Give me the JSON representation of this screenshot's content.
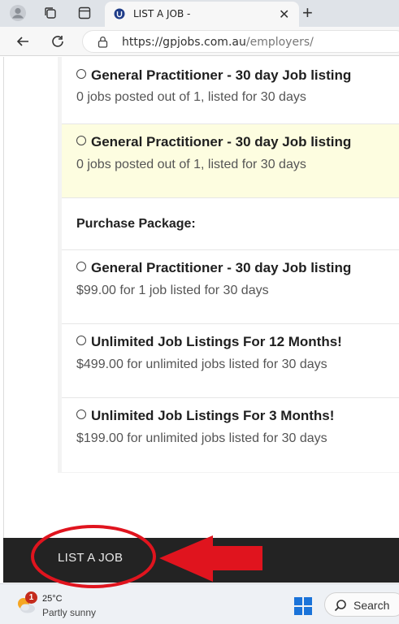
{
  "browser": {
    "tab_title": "LIST A JOB -",
    "url_main": "https://gpjobs.com.au",
    "url_path": "/employers/"
  },
  "listings": [
    {
      "title": "General Practitioner - 30 day Job listing",
      "subtitle": "0 jobs posted out of 1, listed for 30 days",
      "highlighted": false
    },
    {
      "title": "General Practitioner - 30 day Job listing",
      "subtitle": "0 jobs posted out of 1, listed for 30 days",
      "highlighted": true
    }
  ],
  "purchase": {
    "heading": "Purchase Package:",
    "packages": [
      {
        "title": "General Practitioner - 30 day Job listing",
        "subtitle": "$99.00 for 1 job listed for 30 days"
      },
      {
        "title": "Unlimited Job Listings For 12 Months!",
        "subtitle": "$499.00 for unlimited jobs listed for 30 days"
      },
      {
        "title": "Unlimited Job Listings For 3 Months!",
        "subtitle": "$199.00 for unlimited jobs listed for 30 days"
      }
    ]
  },
  "footer": {
    "link_label": "LIST A JOB"
  },
  "taskbar": {
    "weather_badge": "1",
    "temperature": "25°C",
    "condition": "Partly sunny",
    "search_label": "Search"
  },
  "colors": {
    "highlight_row": "#fdfde0",
    "footer_bg": "#232323",
    "annotation_red": "#e0141e"
  },
  "icons": [
    "profile-icon",
    "tab-groups-icon",
    "tab-actions-icon",
    "site-favicon",
    "close-icon",
    "plus-icon",
    "back-arrow-icon",
    "refresh-icon",
    "lock-icon",
    "weather-icon",
    "windows-logo-icon",
    "search-icon"
  ]
}
